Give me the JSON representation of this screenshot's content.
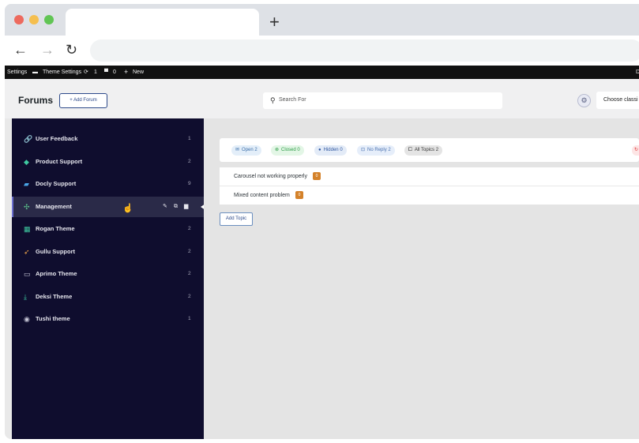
{
  "adminbar": {
    "settings": "Settings",
    "theme_settings": "Theme Settings",
    "updates_count": "1",
    "comments_count": "0",
    "new_label": "New",
    "right_label": "D"
  },
  "header": {
    "title": "Forums",
    "add_forum": "Add Forum",
    "search_placeholder": "Search For",
    "choose_label": "Choose classi"
  },
  "sidebar": {
    "items": [
      {
        "label": "User Feedback",
        "count": "1",
        "icon": "link-icon"
      },
      {
        "label": "Product Support",
        "count": "2",
        "icon": "diamond-icon"
      },
      {
        "label": "Docly Support",
        "count": "9",
        "icon": "chat-icon"
      },
      {
        "label": "Management",
        "count": "",
        "icon": "tools-icon"
      },
      {
        "label": "Rogan Theme",
        "count": "2",
        "icon": "grid-icon"
      },
      {
        "label": "Gullu Support",
        "count": "2",
        "icon": "rocket-icon"
      },
      {
        "label": "Aprimo Theme",
        "count": "2",
        "icon": "monitor-icon"
      },
      {
        "label": "Deksi Theme",
        "count": "2",
        "icon": "download-icon"
      },
      {
        "label": "Tushi theme",
        "count": "1",
        "icon": "globe-icon"
      }
    ]
  },
  "filters": [
    {
      "label": "Open",
      "count": "2",
      "icon": "mail-icon",
      "bg": "#e3eef9",
      "fg": "#3a6ea8"
    },
    {
      "label": "Closed",
      "count": "0",
      "icon": "x-circle-icon",
      "bg": "#e3f6e6",
      "fg": "#2e9d48"
    },
    {
      "label": "Hidden",
      "count": "0",
      "icon": "eye-off-icon",
      "bg": "#e3ebf7",
      "fg": "#3057a0"
    },
    {
      "label": "No Reply",
      "count": "2",
      "icon": "inbox-icon",
      "bg": "#e6eefa",
      "fg": "#4a72b0"
    },
    {
      "label": "All Topics",
      "count": "2",
      "icon": "comments-icon",
      "bg": "#e4e4e4",
      "fg": "#333333"
    }
  ],
  "topics": [
    {
      "title": "Carousel not working properly",
      "badge": "0"
    },
    {
      "title": "Mixed content problem",
      "badge": "0"
    }
  ],
  "add_topic": "Add Topic",
  "colors": {
    "sidebar_bg": "#0f0d2e",
    "active_item_bg": "#2a2a48",
    "accent_blue": "#2d4a8a",
    "badge_orange": "#d4822a"
  }
}
